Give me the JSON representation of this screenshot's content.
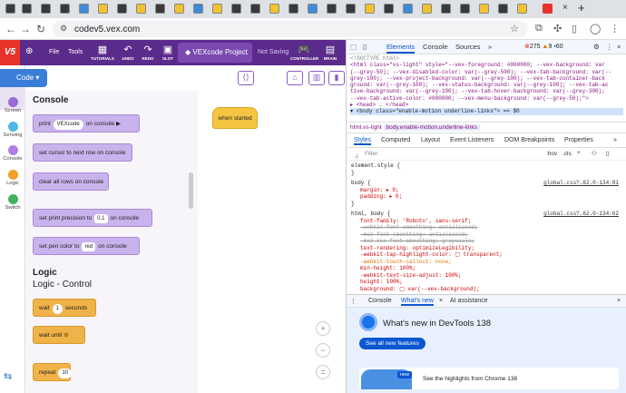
{
  "browser": {
    "url": "codev5.vex.com",
    "tab_close": "×",
    "new_tab": "+"
  },
  "vex": {
    "logo": "V5",
    "menu_file": "File",
    "menu_tools": "Tools",
    "tutorials": "TUTORIALS",
    "undo": "UNDO",
    "redo": "REDO",
    "slot": "SLOT",
    "project_name": "VEXcode Project",
    "save_status": "Not Saving",
    "controller": "CONTROLLER",
    "brain": "BRAIN",
    "code_tab": "Code",
    "categories": [
      "Screen",
      "Sensing",
      "Console",
      "Logic",
      "Switch"
    ],
    "category_colors": [
      "#9b6ad6",
      "#4fb6e8",
      "#b07ee0",
      "#f0a028",
      "#44b35e"
    ],
    "console_title": "Console",
    "blocks": {
      "print_prefix": "print",
      "print_value": "VEXcode",
      "print_suffix": "on console",
      "cursor_next_row": "set cursor to next row on console",
      "clear_rows": "clear all rows on console",
      "precision_prefix": "set print precision to",
      "precision_value": "0.1",
      "precision_suffix": "on console",
      "pen_prefix": "set pen color to",
      "pen_value": "red",
      "pen_suffix": "on console",
      "wait_prefix": "wait",
      "wait_value": "1",
      "wait_suffix": "seconds",
      "wait_until": "wait until",
      "repeat_prefix": "repeat",
      "repeat_value": "10"
    },
    "logic_title": "Logic",
    "logic_subtitle": "Logic - Control",
    "when_started": "when started"
  },
  "devtools": {
    "tabs": [
      "Elements",
      "Console",
      "Sources"
    ],
    "errors": "275",
    "warnings": "9",
    "infos": "60",
    "dom_lines": [
      "<!DOCTYPE html>",
      "<html class=\"vs-light\" style=\"--vex-foreground: #000000; --vex-background: var",
      "(--grey-50); --vex-disabled-color: var(--grey-500); --vex-tab-background: var(--",
      "grey-100); --vex-project-background: var(--grey-100); --vex-tab-container-back",
      "ground: var(--grey-100); --vex-status-background: var(--grey-100); --vex-tab-ac",
      "tive-background: var(--grey-100); --vex-tab-hover-background: var(--grey-300);",
      "--vex-tab-active-color: #000000; --vex-menu-background: var(--grey-50);\">",
      "▸ <head> … </head>",
      "▾ <body class=\"enable-motion underline-links\"> == $0"
    ],
    "crumb_1": "html.vs-light",
    "crumb_2": "body.enable-motion.underline-links",
    "subtabs": [
      "Styles",
      "Computed",
      "Layout",
      "Event Listeners",
      "DOM Breakpoints",
      "Properties"
    ],
    "filter_placeholder": "Filter",
    "filter_hov": ":hov",
    "filter_cls": ".cls",
    "style_lines": {
      "element_style": "element.style {",
      "close": "}",
      "body_sel": "body {",
      "body_src": "global.css?…62.0-134:81",
      "margin": "margin: ▸ 0;",
      "padding": "padding: ▸ 0;",
      "html_body_sel": "html, body {",
      "html_body_src": "global.css?…62.0-134:62",
      "font_family": "font-family: 'Roboto', sans-serif;",
      "webkit_smoothing": "-webkit-font-smoothing: antialiased;",
      "moz_smoothing": "-moz-font-smoothing: antialiased;",
      "moz_osx": "-moz-osx-font-smoothing: grayscale;",
      "text_rendering": "text-rendering: optimizeLegibility;",
      "tap_highlight": "-webkit-tap-highlight-color: ▢ transparent;",
      "touch_callout": "-webkit-touch-callout: none;",
      "min_height": "min-height: 100%;",
      "text_size_adjust": "-webkit-text-size-adjust: 100%;",
      "height": "height: 100%;",
      "background": "background: ▢ var(--vex-background);"
    },
    "drawer_tabs": [
      "Console",
      "What's new",
      "AI assistance"
    ],
    "whats_new_title": "What's new in DevTools 138",
    "see_all": "See all new features",
    "new_badge": "new",
    "card_text": "See the highlights from Chrome 138"
  }
}
